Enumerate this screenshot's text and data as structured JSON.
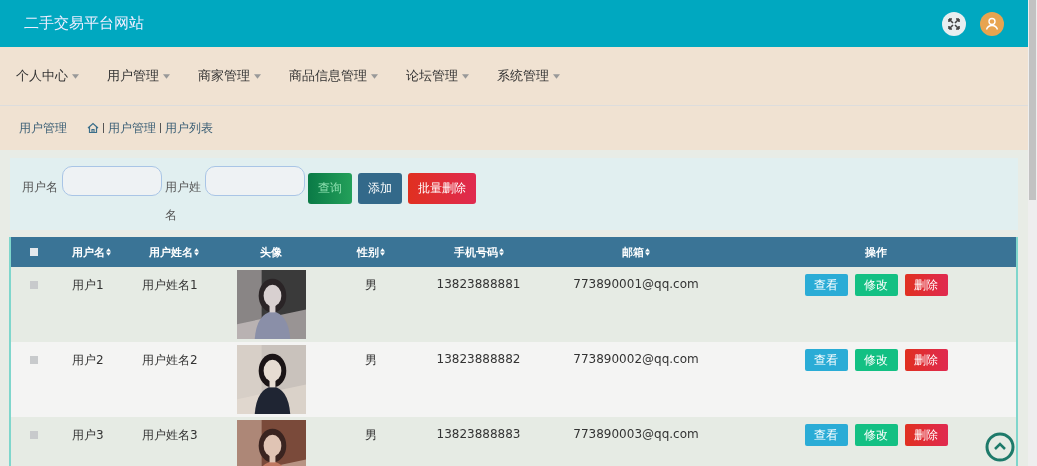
{
  "header": {
    "title": "二手交易平台网站"
  },
  "nav": [
    {
      "label": "个人中心"
    },
    {
      "label": "用户管理"
    },
    {
      "label": "商家管理"
    },
    {
      "label": "商品信息管理"
    },
    {
      "label": "论坛管理"
    },
    {
      "label": "系统管理"
    }
  ],
  "breadcrumb": {
    "title": "用户管理",
    "path": [
      "用户管理",
      "用户列表"
    ]
  },
  "search": {
    "fields": [
      {
        "label": "用户名"
      },
      {
        "label": "用户姓名"
      }
    ],
    "buttons": [
      {
        "label": "查询",
        "kind": "query"
      },
      {
        "label": "添加",
        "kind": "add"
      },
      {
        "label": "批量删除",
        "kind": "delete"
      }
    ]
  },
  "table": {
    "select_all": {
      "checked": false
    },
    "columns": [
      {
        "label": "用户名",
        "sortable": true
      },
      {
        "label": "用户姓名",
        "sortable": true
      },
      {
        "label": "头像",
        "sortable": false
      },
      {
        "label": "性别",
        "sortable": true
      },
      {
        "label": "手机号码",
        "sortable": true
      },
      {
        "label": "邮箱",
        "sortable": true
      },
      {
        "label": "操作",
        "sortable": false
      }
    ],
    "rows": [
      {
        "checked": false,
        "username": "用户1",
        "name": "用户姓名1",
        "gender": "男",
        "phone": "13823888881",
        "email": "773890001@qq.com",
        "actions": [
          {
            "label": "查看",
            "kind": "view"
          },
          {
            "label": "修改",
            "kind": "edit"
          },
          {
            "label": "删除",
            "kind": "delete"
          }
        ]
      },
      {
        "checked": false,
        "username": "用户2",
        "name": "用户姓名2",
        "gender": "男",
        "phone": "13823888882",
        "email": "773890002@qq.com",
        "actions": [
          {
            "label": "查看",
            "kind": "view"
          },
          {
            "label": "修改",
            "kind": "edit"
          },
          {
            "label": "删除",
            "kind": "delete"
          }
        ]
      },
      {
        "checked": false,
        "username": "用户3",
        "name": "用户姓名3",
        "gender": "男",
        "phone": "13823888883",
        "email": "773890003@qq.com",
        "actions": [
          {
            "label": "查看",
            "kind": "view"
          },
          {
            "label": "修改",
            "kind": "edit"
          },
          {
            "label": "删除",
            "kind": "delete"
          }
        ]
      }
    ]
  }
}
